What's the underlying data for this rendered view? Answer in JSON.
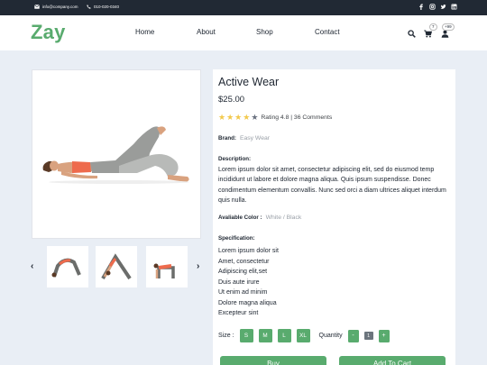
{
  "topbar": {
    "email": "info@company.com",
    "phone": "010-020-0340",
    "social_icons": [
      "facebook-icon",
      "instagram-icon",
      "twitter-icon",
      "linkedin-icon"
    ]
  },
  "brand": {
    "logo": "Zay"
  },
  "nav": {
    "home": "Home",
    "about": "About",
    "shop": "Shop",
    "contact": "Contact"
  },
  "header_icons": {
    "cart_count": "7",
    "user_count": "+99"
  },
  "product": {
    "title": "Active Wear",
    "price": "$25.00",
    "rating_value": 4,
    "rating_text": "Rating 4.8 | 36 Comments",
    "brand_label": "Brand:",
    "brand_value": "Easy Wear",
    "description_label": "Description:",
    "description": "Lorem ipsum dolor sit amet, consectetur adipiscing elit, sed do eiusmod temp incididunt ut labore et dolore magna aliqua. Quis ipsum suspendisse. Donec condimentum elementum convallis. Nunc sed orci a diam ultrices aliquet interdum quis nulla.",
    "color_label": "Avaliable Color :",
    "color_value": "White / Black",
    "spec_label": "Specification:",
    "specs": [
      "Lorem ipsum dolor sit",
      "Amet, consectetur",
      "Adipiscing elit,set",
      "Duis aute irure",
      "Ut enim ad minim",
      "Dolore magna aliqua",
      "Excepteur sint"
    ],
    "size_label": "Size :",
    "sizes": [
      "S",
      "M",
      "L",
      "XL"
    ],
    "quantity_label": "Quantity",
    "quantity_minus": "-",
    "quantity_value": "1",
    "quantity_plus": "+",
    "buy_label": "Buy",
    "cart_label": "Add To Cart"
  },
  "gallery": {
    "prev": "‹",
    "next": "›"
  },
  "colors": {
    "accent": "#59ab6e",
    "dark": "#212934",
    "bg": "#e9eef5"
  }
}
